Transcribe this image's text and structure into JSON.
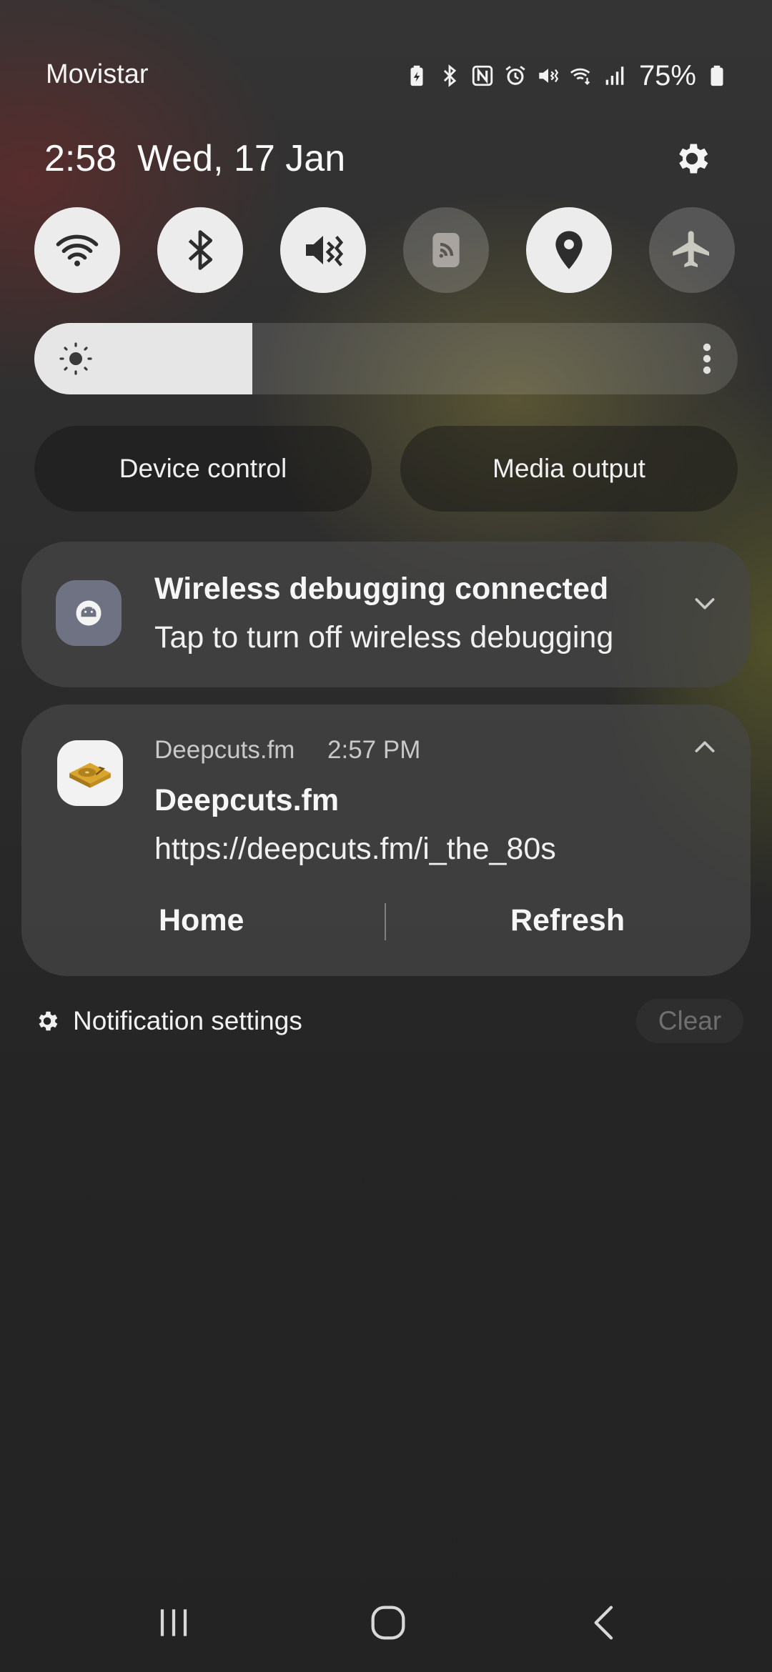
{
  "status_bar": {
    "carrier": "Movistar",
    "battery_percent": "75%",
    "icons": [
      "battery-saver-icon",
      "bluetooth-icon",
      "nfc-icon",
      "alarm-icon",
      "mute-icon",
      "wifi-calling-icon",
      "signal-icon",
      "battery-icon"
    ]
  },
  "header": {
    "time": "2:58",
    "date": "Wed, 17 Jan"
  },
  "quick_toggles": [
    {
      "name": "wifi",
      "icon": "wifi-icon",
      "active": true
    },
    {
      "name": "bluetooth",
      "icon": "bluetooth-icon",
      "active": true
    },
    {
      "name": "mute",
      "icon": "mute-icon",
      "active": true
    },
    {
      "name": "cast",
      "icon": "cast-icon",
      "active": false
    },
    {
      "name": "location",
      "icon": "location-icon",
      "active": true
    },
    {
      "name": "airplane-mode",
      "icon": "airplane-icon",
      "active": false
    }
  ],
  "brightness": {
    "level_fraction": 0.31
  },
  "pills": {
    "device_control": "Device control",
    "media_output": "Media output"
  },
  "notifications": [
    {
      "icon": "debug-icon",
      "title": "Wireless debugging connected",
      "body": "Tap to turn off wireless debugging",
      "expanded": false
    },
    {
      "icon": "turntable-icon",
      "app": "Deepcuts.fm",
      "time": "2:57 PM",
      "title": "Deepcuts.fm",
      "body": "https://deepcuts.fm/i_the_80s",
      "expanded": true,
      "actions": [
        "Home",
        "Refresh"
      ]
    }
  ],
  "footer": {
    "settings_label": "Notification settings",
    "clear_label": "Clear"
  },
  "colors": {
    "toggle_on": "#ececec",
    "toggle_icon": "#2d2d2d",
    "accent_turntable": "#d9a52e"
  }
}
